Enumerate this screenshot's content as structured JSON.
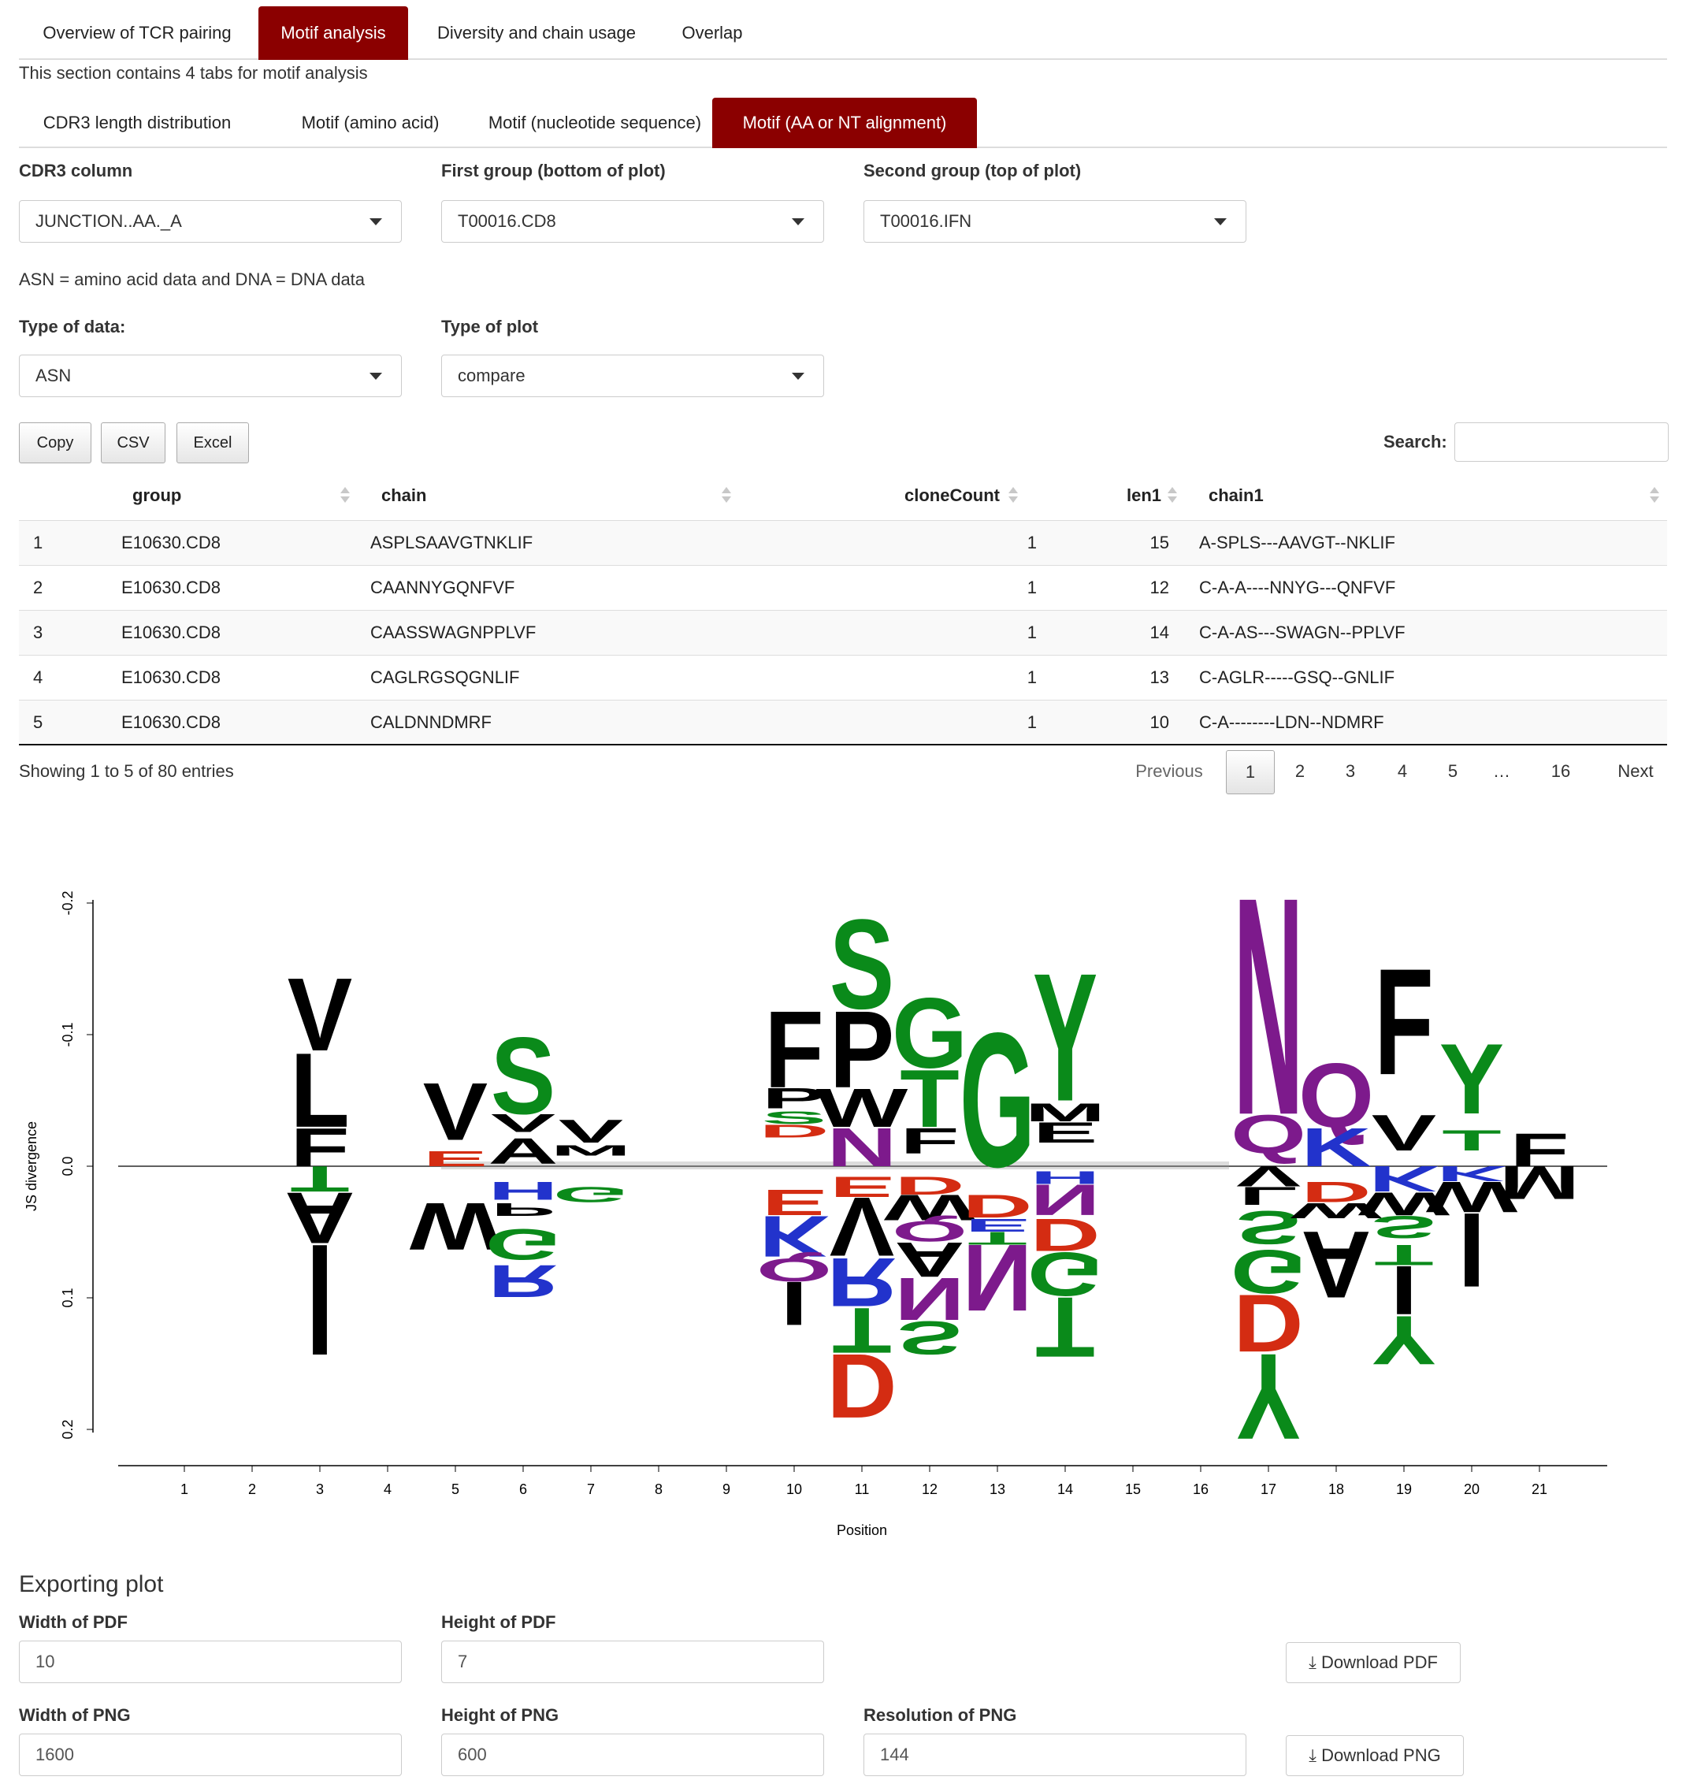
{
  "main_tabs": [
    {
      "label": "Overview of TCR pairing",
      "active": false
    },
    {
      "label": "Motif analysis",
      "active": true
    },
    {
      "label": "Diversity and chain usage",
      "active": false
    },
    {
      "label": "Overlap",
      "active": false
    }
  ],
  "section_intro": "This section contains 4 tabs for motif analysis",
  "sub_tabs": [
    {
      "label": "CDR3 length distribution",
      "active": false
    },
    {
      "label": "Motif (amino acid)",
      "active": false
    },
    {
      "label": "Motif (nucleotide sequence)",
      "active": false
    },
    {
      "label": "Motif (AA or NT alignment)",
      "active": true
    }
  ],
  "controls": {
    "cdr3_column": {
      "label": "CDR3 column",
      "value": "JUNCTION..AA._A"
    },
    "first_group": {
      "label": "First group (bottom of plot)",
      "value": "T00016.CD8"
    },
    "second_group": {
      "label": "Second group (top of plot)",
      "value": "T00016.IFN"
    },
    "data_note": "ASN = amino acid data and DNA = DNA data",
    "data_type": {
      "label": "Type of data:",
      "value": "ASN"
    },
    "plot_type": {
      "label": "Type of plot",
      "value": "compare"
    }
  },
  "table_buttons": {
    "copy": "Copy",
    "csv": "CSV",
    "excel": "Excel"
  },
  "search": {
    "label": "Search:",
    "value": ""
  },
  "table": {
    "columns": [
      "group",
      "chain",
      "cloneCount",
      "len1",
      "chain1"
    ],
    "rows": [
      {
        "idx": "1",
        "group": "E10630.CD8",
        "chain": "ASPLSAAVGTNKLIF",
        "cloneCount": "1",
        "len1": "15",
        "chain1": "A-SPLS---AAVGT--NKLIF"
      },
      {
        "idx": "2",
        "group": "E10630.CD8",
        "chain": "CAANNYGQNFVF",
        "cloneCount": "1",
        "len1": "12",
        "chain1": "C-A-A----NNYG---QNFVF"
      },
      {
        "idx": "3",
        "group": "E10630.CD8",
        "chain": "CAASSWAGNPPLVF",
        "cloneCount": "1",
        "len1": "14",
        "chain1": "C-A-AS---SWAGN--PPLVF"
      },
      {
        "idx": "4",
        "group": "E10630.CD8",
        "chain": "CAGLRGSQGNLIF",
        "cloneCount": "1",
        "len1": "13",
        "chain1": "C-AGLR-----GSQ--GNLIF"
      },
      {
        "idx": "5",
        "group": "E10630.CD8",
        "chain": "CALDNNDMRF",
        "cloneCount": "1",
        "len1": "10",
        "chain1": "C-A--------LDN--NDMRF"
      }
    ],
    "info": "Showing 1 to 5 of 80 entries",
    "pagination": {
      "previous": "Previous",
      "pages": [
        "1",
        "2",
        "3",
        "4",
        "5",
        "…",
        "16"
      ],
      "current": "1",
      "next": "Next"
    }
  },
  "chart_data": {
    "type": "sequence-logo",
    "xlabel": "Position",
    "ylabel": "JS divergence",
    "x_ticks": [
      "1",
      "2",
      "3",
      "4",
      "5",
      "6",
      "7",
      "8",
      "9",
      "10",
      "11",
      "12",
      "13",
      "14",
      "15",
      "16",
      "17",
      "18",
      "19",
      "20",
      "21"
    ],
    "y_ticks": [
      "-0.2",
      "-0.1",
      "0.0",
      "0.1",
      "0.2"
    ],
    "ylim": [
      0.2,
      -0.2
    ],
    "palette": {
      "black": "#000000",
      "green": "#0a8a1a",
      "red": "#d42c12",
      "blue": "#2233cc",
      "purple": "#7d1a8c"
    },
    "glyphs": [
      {
        "pos": 3,
        "letter": "V",
        "color": "#000000",
        "y0": -0.145,
        "y1": -0.088
      },
      {
        "pos": 3,
        "letter": "L",
        "color": "#000000",
        "y0": -0.088,
        "y1": -0.03
      },
      {
        "pos": 3,
        "letter": "F",
        "color": "#000000",
        "y0": -0.03,
        "y1": 0.0
      },
      {
        "pos": 3,
        "letter": "T",
        "color": "#0a8a1a",
        "y0": 0.0,
        "y1": 0.02,
        "flip": true
      },
      {
        "pos": 3,
        "letter": "A",
        "color": "#000000",
        "y0": 0.02,
        "y1": 0.06,
        "flip": true
      },
      {
        "pos": 3,
        "letter": "I",
        "color": "#000000",
        "y0": 0.06,
        "y1": 0.147,
        "flip": true
      },
      {
        "pos": 5,
        "letter": "V",
        "color": "#000000",
        "y0": -0.065,
        "y1": -0.02
      },
      {
        "pos": 5,
        "letter": "E",
        "color": "#d42c12",
        "y0": -0.012,
        "y1": 0.0
      },
      {
        "pos": 5,
        "letter": "W",
        "color": "#000000",
        "y0": 0.028,
        "y1": 0.065,
        "flip": true
      },
      {
        "pos": 6,
        "letter": "S",
        "color": "#0a8a1a",
        "y0": -0.1,
        "y1": -0.04
      },
      {
        "pos": 6,
        "letter": "V",
        "color": "#000000",
        "y0": -0.04,
        "y1": -0.026
      },
      {
        "pos": 6,
        "letter": "A",
        "color": "#000000",
        "y0": -0.022,
        "y1": -0.002
      },
      {
        "pos": 6,
        "letter": "H",
        "color": "#2233cc",
        "y0": 0.012,
        "y1": 0.026,
        "flip": true
      },
      {
        "pos": 6,
        "letter": "P",
        "color": "#000000",
        "y0": 0.028,
        "y1": 0.038,
        "flip": true
      },
      {
        "pos": 6,
        "letter": "G",
        "color": "#0a8a1a",
        "y0": 0.048,
        "y1": 0.072,
        "flip": true
      },
      {
        "pos": 6,
        "letter": "R",
        "color": "#2233cc",
        "y0": 0.075,
        "y1": 0.1,
        "flip": true
      },
      {
        "pos": 7,
        "letter": "V",
        "color": "#000000",
        "y0": -0.036,
        "y1": -0.018
      },
      {
        "pos": 7,
        "letter": "M",
        "color": "#000000",
        "y0": -0.016,
        "y1": -0.008
      },
      {
        "pos": 7,
        "letter": "G",
        "color": "#0a8a1a",
        "y0": 0.016,
        "y1": 0.028,
        "flip": true
      },
      {
        "pos": 10,
        "letter": "F",
        "color": "#000000",
        "y0": -0.12,
        "y1": -0.06
      },
      {
        "pos": 10,
        "letter": "P",
        "color": "#000000",
        "y0": -0.06,
        "y1": -0.044
      },
      {
        "pos": 10,
        "letter": "S",
        "color": "#0a8a1a",
        "y0": -0.042,
        "y1": -0.032
      },
      {
        "pos": 10,
        "letter": "D",
        "color": "#d42c12",
        "y0": -0.032,
        "y1": -0.022
      },
      {
        "pos": 10,
        "letter": "E",
        "color": "#d42c12",
        "y0": 0.018,
        "y1": 0.038,
        "flip": true
      },
      {
        "pos": 10,
        "letter": "K",
        "color": "#2233cc",
        "y0": 0.038,
        "y1": 0.07,
        "flip": true
      },
      {
        "pos": 10,
        "letter": "Q",
        "color": "#7d1a8c",
        "y0": 0.07,
        "y1": 0.088,
        "flip": true
      },
      {
        "pos": 10,
        "letter": "I",
        "color": "#000000",
        "y0": 0.088,
        "y1": 0.122,
        "flip": true
      },
      {
        "pos": 11,
        "letter": "S",
        "color": "#0a8a1a",
        "y0": -0.19,
        "y1": -0.12
      },
      {
        "pos": 11,
        "letter": "P",
        "color": "#000000",
        "y0": -0.12,
        "y1": -0.06
      },
      {
        "pos": 11,
        "letter": "W",
        "color": "#000000",
        "y0": -0.06,
        "y1": -0.03
      },
      {
        "pos": 11,
        "letter": "N",
        "color": "#7d1a8c",
        "y0": -0.03,
        "y1": 0.0
      },
      {
        "pos": 11,
        "letter": "E",
        "color": "#d42c12",
        "y0": 0.008,
        "y1": 0.024,
        "flip": true
      },
      {
        "pos": 11,
        "letter": "V",
        "color": "#000000",
        "y0": 0.024,
        "y1": 0.07,
        "flip": true
      },
      {
        "pos": 11,
        "letter": "R",
        "color": "#2233cc",
        "y0": 0.07,
        "y1": 0.108,
        "flip": true
      },
      {
        "pos": 11,
        "letter": "T",
        "color": "#0a8a1a",
        "y0": 0.108,
        "y1": 0.143,
        "flip": true
      },
      {
        "pos": 11,
        "letter": "D",
        "color": "#d42c12",
        "y0": 0.143,
        "y1": 0.193,
        "flip": true
      },
      {
        "pos": 12,
        "letter": "G",
        "color": "#0a8a1a",
        "y0": -0.13,
        "y1": -0.075
      },
      {
        "pos": 12,
        "letter": "T",
        "color": "#0a8a1a",
        "y0": -0.075,
        "y1": -0.03
      },
      {
        "pos": 12,
        "letter": "F",
        "color": "#000000",
        "y0": -0.03,
        "y1": -0.01
      },
      {
        "pos": 12,
        "letter": "D",
        "color": "#d42c12",
        "y0": 0.008,
        "y1": 0.022,
        "flip": true
      },
      {
        "pos": 12,
        "letter": "W",
        "color": "#000000",
        "y0": 0.022,
        "y1": 0.042,
        "flip": true
      },
      {
        "pos": 12,
        "letter": "Q",
        "color": "#7d1a8c",
        "y0": 0.042,
        "y1": 0.058,
        "flip": true
      },
      {
        "pos": 12,
        "letter": "A",
        "color": "#000000",
        "y0": 0.058,
        "y1": 0.085,
        "flip": true
      },
      {
        "pos": 12,
        "letter": "N",
        "color": "#7d1a8c",
        "y0": 0.085,
        "y1": 0.118,
        "flip": true
      },
      {
        "pos": 12,
        "letter": "S",
        "color": "#0a8a1a",
        "y0": 0.118,
        "y1": 0.144,
        "flip": true
      },
      {
        "pos": 13,
        "letter": "G",
        "color": "#0a8a1a",
        "y0": -0.105,
        "y1": 0.0
      },
      {
        "pos": 13,
        "letter": "D",
        "color": "#d42c12",
        "y0": 0.022,
        "y1": 0.04,
        "flip": true
      },
      {
        "pos": 13,
        "letter": "E",
        "color": "#2233cc",
        "y0": 0.04,
        "y1": 0.05,
        "flip": true
      },
      {
        "pos": 13,
        "letter": "T",
        "color": "#0a8a1a",
        "y0": 0.05,
        "y1": 0.06,
        "flip": true
      },
      {
        "pos": 13,
        "letter": "N",
        "color": "#7d1a8c",
        "y0": 0.06,
        "y1": 0.112,
        "flip": true
      },
      {
        "pos": 14,
        "letter": "Y",
        "color": "#0a8a1a",
        "y0": -0.15,
        "y1": -0.05
      },
      {
        "pos": 14,
        "letter": "M",
        "color": "#000000",
        "y0": -0.048,
        "y1": -0.034
      },
      {
        "pos": 14,
        "letter": "E",
        "color": "#000000",
        "y0": -0.034,
        "y1": -0.018
      },
      {
        "pos": 14,
        "letter": "H",
        "color": "#2233cc",
        "y0": 0.004,
        "y1": 0.014,
        "flip": true
      },
      {
        "pos": 14,
        "letter": "N",
        "color": "#7d1a8c",
        "y0": 0.014,
        "y1": 0.038,
        "flip": true
      },
      {
        "pos": 14,
        "letter": "D",
        "color": "#d42c12",
        "y0": 0.04,
        "y1": 0.065,
        "flip": true
      },
      {
        "pos": 14,
        "letter": "G",
        "color": "#0a8a1a",
        "y0": 0.066,
        "y1": 0.1,
        "flip": true
      },
      {
        "pos": 14,
        "letter": "T",
        "color": "#0a8a1a",
        "y0": 0.1,
        "y1": 0.147,
        "flip": true
      },
      {
        "pos": 17,
        "letter": "N",
        "color": "#7d1a8c",
        "y0": -0.21,
        "y1": -0.04
      },
      {
        "pos": 17,
        "letter": "Q",
        "color": "#7d1a8c",
        "y0": -0.04,
        "y1": -0.01
      },
      {
        "pos": 17,
        "letter": "V",
        "color": "#000000",
        "y0": 0.0,
        "y1": 0.016,
        "flip": true
      },
      {
        "pos": 17,
        "letter": "L",
        "color": "#000000",
        "y0": 0.016,
        "y1": 0.03,
        "flip": true
      },
      {
        "pos": 17,
        "letter": "S",
        "color": "#0a8a1a",
        "y0": 0.034,
        "y1": 0.06,
        "flip": true
      },
      {
        "pos": 17,
        "letter": "G",
        "color": "#0a8a1a",
        "y0": 0.064,
        "y1": 0.098,
        "flip": true
      },
      {
        "pos": 17,
        "letter": "D",
        "color": "#d42c12",
        "y0": 0.098,
        "y1": 0.143,
        "flip": true
      },
      {
        "pos": 17,
        "letter": "Y",
        "color": "#0a8a1a",
        "y0": 0.143,
        "y1": 0.21,
        "flip": true
      },
      {
        "pos": 18,
        "letter": "Q",
        "color": "#7d1a8c",
        "y0": -0.08,
        "y1": -0.03
      },
      {
        "pos": 18,
        "letter": "K",
        "color": "#2233cc",
        "y0": -0.03,
        "y1": 0.0
      },
      {
        "pos": 18,
        "letter": "D",
        "color": "#d42c12",
        "y0": 0.012,
        "y1": 0.028,
        "flip": true
      },
      {
        "pos": 18,
        "letter": "W",
        "color": "#000000",
        "y0": 0.028,
        "y1": 0.04,
        "flip": true
      },
      {
        "pos": 18,
        "letter": "A",
        "color": "#000000",
        "y0": 0.05,
        "y1": 0.102,
        "flip": true
      },
      {
        "pos": 19,
        "letter": "F",
        "color": "#000000",
        "y0": -0.153,
        "y1": -0.07
      },
      {
        "pos": 19,
        "letter": "V",
        "color": "#000000",
        "y0": -0.04,
        "y1": -0.012
      },
      {
        "pos": 19,
        "letter": "K",
        "color": "#2233cc",
        "y0": 0.0,
        "y1": 0.02,
        "flip": true
      },
      {
        "pos": 19,
        "letter": "W",
        "color": "#000000",
        "y0": 0.02,
        "y1": 0.038,
        "flip": true
      },
      {
        "pos": 19,
        "letter": "S",
        "color": "#0a8a1a",
        "y0": 0.038,
        "y1": 0.055,
        "flip": true
      },
      {
        "pos": 19,
        "letter": "T",
        "color": "#0a8a1a",
        "y0": 0.06,
        "y1": 0.076,
        "flip": true
      },
      {
        "pos": 19,
        "letter": "I",
        "color": "#000000",
        "y0": 0.076,
        "y1": 0.114,
        "flip": true
      },
      {
        "pos": 19,
        "letter": "Y",
        "color": "#0a8a1a",
        "y0": 0.114,
        "y1": 0.152,
        "flip": true
      },
      {
        "pos": 20,
        "letter": "Y",
        "color": "#0a8a1a",
        "y0": -0.095,
        "y1": -0.04
      },
      {
        "pos": 20,
        "letter": "T",
        "color": "#0a8a1a",
        "y0": -0.028,
        "y1": -0.012
      },
      {
        "pos": 20,
        "letter": "K",
        "color": "#2233cc",
        "y0": 0.0,
        "y1": 0.012,
        "flip": true
      },
      {
        "pos": 20,
        "letter": "W",
        "color": "#000000",
        "y0": 0.012,
        "y1": 0.036,
        "flip": true
      },
      {
        "pos": 20,
        "letter": "I",
        "color": "#000000",
        "y0": 0.036,
        "y1": 0.094,
        "flip": true
      },
      {
        "pos": 21,
        "letter": "F",
        "color": "#000000",
        "y0": -0.026,
        "y1": 0.0
      },
      {
        "pos": 21,
        "letter": "M",
        "color": "#000000",
        "y0": 0.0,
        "y1": 0.026,
        "flip": true
      }
    ]
  },
  "export": {
    "title": "Exporting plot",
    "width_pdf": {
      "label": "Width of PDF",
      "value": "10"
    },
    "height_pdf": {
      "label": "Height of PDF",
      "value": "7"
    },
    "download_pdf": "Download PDF",
    "width_png": {
      "label": "Width of PNG",
      "value": "1600"
    },
    "height_png": {
      "label": "Height of PNG",
      "value": "600"
    },
    "resolution_png": {
      "label": "Resolution of PNG",
      "value": "144"
    },
    "download_png": "Download PNG"
  }
}
